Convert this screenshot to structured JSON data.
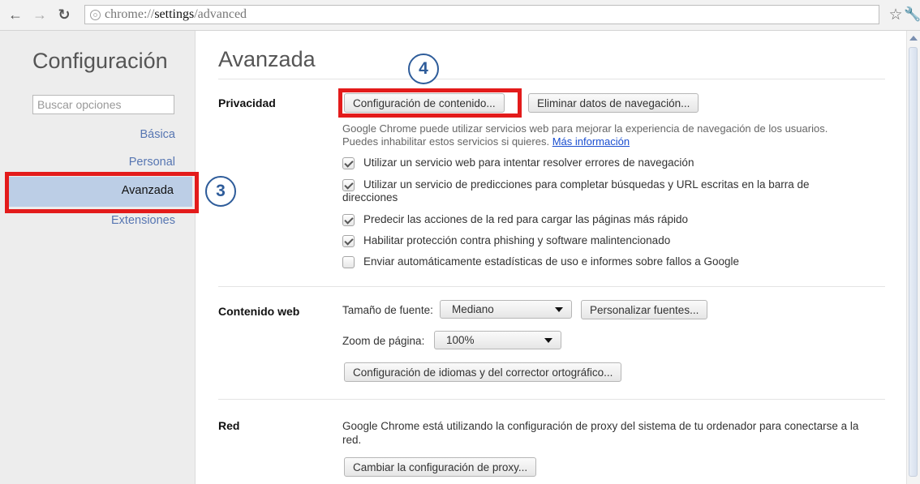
{
  "browser": {
    "url_scheme": "chrome://",
    "url_host": "settings",
    "url_path": "/advanced"
  },
  "sidebar": {
    "title": "Configuración",
    "search_placeholder": "Buscar opciones",
    "items": [
      {
        "label": "Básica"
      },
      {
        "label": "Personal"
      },
      {
        "label": "Avanzada",
        "selected": true
      },
      {
        "label": "Extensiones"
      }
    ]
  },
  "annotations": {
    "step_sidebar": "3",
    "step_content_button": "4",
    "highlight_color": "#e31b1b"
  },
  "main": {
    "title": "Avanzada",
    "privacidad": {
      "label": "Privacidad",
      "content_settings_button": "Configuración de contenido...",
      "clear_data_button": "Eliminar datos de navegación...",
      "description_line1": "Google Chrome puede utilizar servicios web para mejorar la experiencia de navegación de los usuarios.",
      "description_line2": "Puedes inhabilitar estos servicios si quieres.",
      "more_info_link": "Más información",
      "options": [
        {
          "label": "Utilizar un servicio web para intentar resolver errores de navegación",
          "checked": true
        },
        {
          "label": "Utilizar un servicio de predicciones para completar búsquedas y URL escritas en la barra de",
          "label_cont": "direcciones",
          "checked": true
        },
        {
          "label": "Predecir las acciones de la red para cargar las páginas más rápido",
          "checked": true
        },
        {
          "label": "Habilitar protección contra phishing y software malintencionado",
          "checked": true
        },
        {
          "label": "Enviar automáticamente estadísticas de uso e informes sobre fallos a Google",
          "checked": false
        }
      ]
    },
    "contenido_web": {
      "label": "Contenido web",
      "font_size_label": "Tamaño de fuente:",
      "font_size_value": "Mediano",
      "customize_fonts_button": "Personalizar fuentes...",
      "zoom_label": "Zoom de página:",
      "zoom_value": "100%",
      "languages_button": "Configuración de idiomas y del corrector ortográfico..."
    },
    "red": {
      "label": "Red",
      "description_line1": "Google Chrome está utilizando la configuración de proxy del sistema de tu ordenador para conectarse a la",
      "description_line2": "red.",
      "proxy_button": "Cambiar la configuración de proxy..."
    }
  }
}
